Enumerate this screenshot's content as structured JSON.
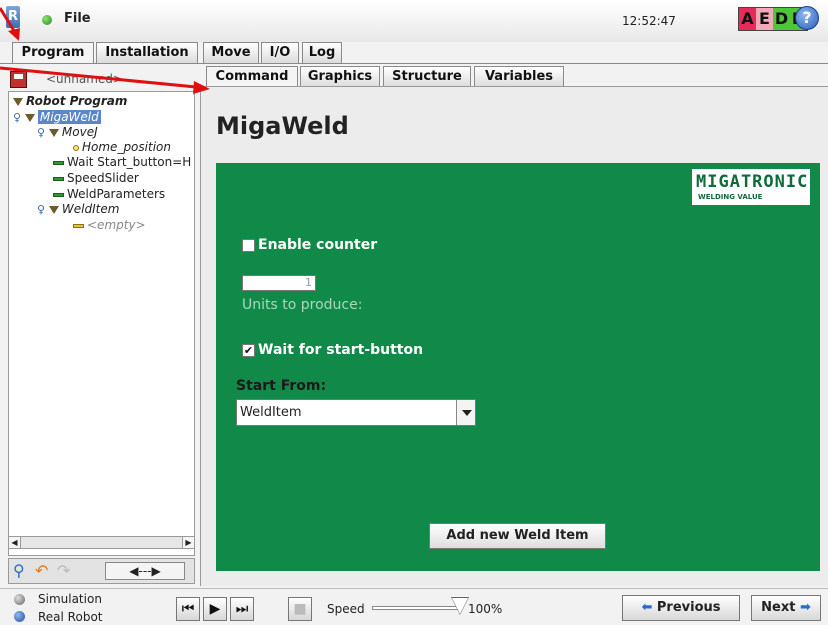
{
  "topbar": {
    "file_label": "File",
    "time": "12:52:47",
    "ur_logo": "R"
  },
  "aedd": [
    {
      "letter": "A",
      "color": "#e8295a"
    },
    {
      "letter": "E",
      "color": "#f4a9b8"
    },
    {
      "letter": "D",
      "color": "#4fc53a"
    },
    {
      "letter": "D",
      "color": "#4fc53a"
    }
  ],
  "help_label": "?",
  "main_tabs": [
    "Program",
    "Installation",
    "Move",
    "I/O",
    "Log"
  ],
  "sub_tabs": [
    "Command",
    "Graphics",
    "Structure",
    "Variables"
  ],
  "filename": "<unnamed>",
  "tree": [
    {
      "label": "Robot Program"
    },
    {
      "label": "MigaWeld"
    },
    {
      "label": "MoveJ"
    },
    {
      "label": "Home_position"
    },
    {
      "label": "Wait Start_button=H"
    },
    {
      "label": "SpeedSlider"
    },
    {
      "label": "WeldParameters"
    },
    {
      "label": "WeldItem"
    },
    {
      "label": "<empty>"
    }
  ],
  "page_title": "MigaWeld",
  "logo": {
    "main": "MIGATRONIC",
    "sub": "WELDING VALUE"
  },
  "form": {
    "enable_counter_label": "Enable counter",
    "enable_counter_checked": false,
    "units_value": "1",
    "units_label": "Units to produce:",
    "wait_label": "Wait for start-button",
    "wait_checked": true,
    "start_from_label": "Start From:",
    "start_from_value": "WeldItem",
    "add_button": "Add new Weld Item",
    "check_mark": "✔"
  },
  "bottom": {
    "simulation_label": "Simulation",
    "real_robot_label": "Real Robot",
    "speed_label": "Speed",
    "speed_value": "100%",
    "previous_label": "Previous",
    "next_label": "Next"
  }
}
